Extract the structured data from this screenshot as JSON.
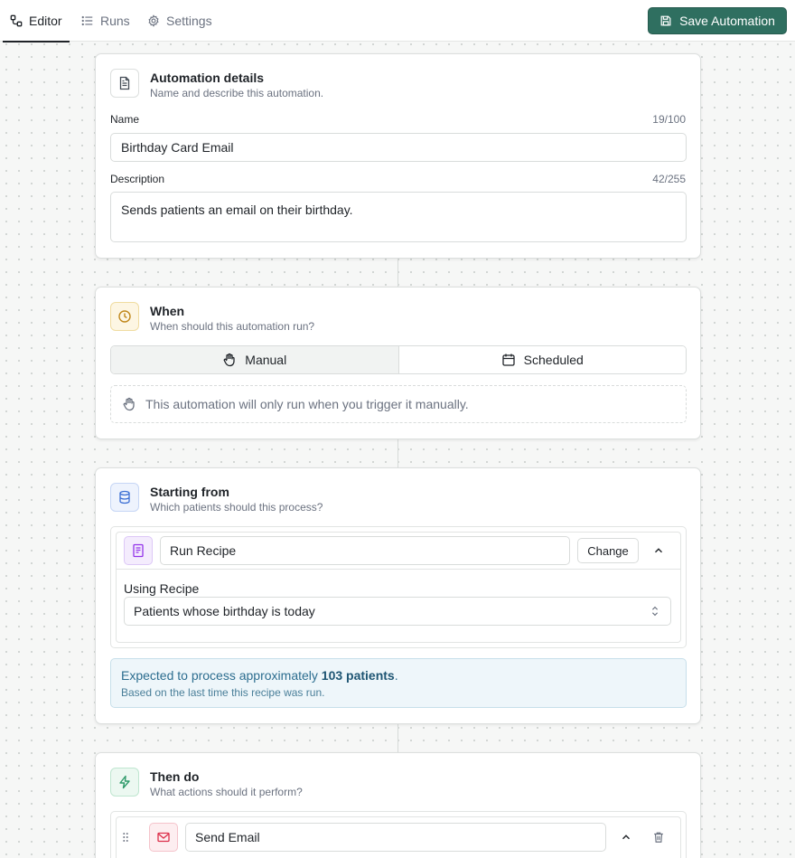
{
  "tabs": {
    "editor": "Editor",
    "runs": "Runs",
    "settings": "Settings"
  },
  "save_button": "Save Automation",
  "details": {
    "title": "Automation details",
    "subtitle": "Name and describe this automation.",
    "name_label": "Name",
    "name_counter": "19/100",
    "name_value": "Birthday Card Email",
    "description_label": "Description",
    "description_counter": "42/255",
    "description_value": "Sends patients an email on their birthday."
  },
  "when": {
    "title": "When",
    "subtitle": "When should this automation run?",
    "manual": "Manual",
    "scheduled": "Scheduled",
    "selected": "Manual",
    "info": "This automation will only run when you trigger it manually."
  },
  "starting": {
    "title": "Starting from",
    "subtitle": "Which patients should this process?",
    "source_value": "Run Recipe",
    "change_button": "Change",
    "using_label": "Using Recipe",
    "recipe_selected": "Patients whose birthday is today",
    "estimate_prefix": "Expected to process approximately",
    "estimate_count": "103 patients",
    "estimate_suffix": ".",
    "estimate_sub": "Based on the last time this recipe was run."
  },
  "then": {
    "title": "Then do",
    "subtitle": "What actions should it perform?",
    "action_value": "Send Email"
  },
  "colors": {
    "primary": "#2f6f60",
    "when_accent": "#e0a423",
    "starting_accent": "#3b6fd4",
    "recipe_accent": "#9333ea",
    "then_accent": "#2f9a6a",
    "email_accent": "#dc2f4a",
    "estimate_text": "#2c6d8f"
  },
  "icons": {
    "editor": "workflow-icon",
    "runs": "list-icon",
    "settings": "gear-icon",
    "save": "floppy-disk-icon",
    "details": "document-icon",
    "when": "clock-icon",
    "manual": "hand-icon",
    "scheduled": "calendar-icon",
    "starting": "database-icon",
    "recipe": "recipe-book-icon",
    "then": "lightning-icon",
    "email": "mail-icon",
    "drag": "grip-vertical-icon",
    "collapse": "chevron-up-icon",
    "delete": "trash-icon",
    "select": "chevrons-up-down-icon"
  }
}
